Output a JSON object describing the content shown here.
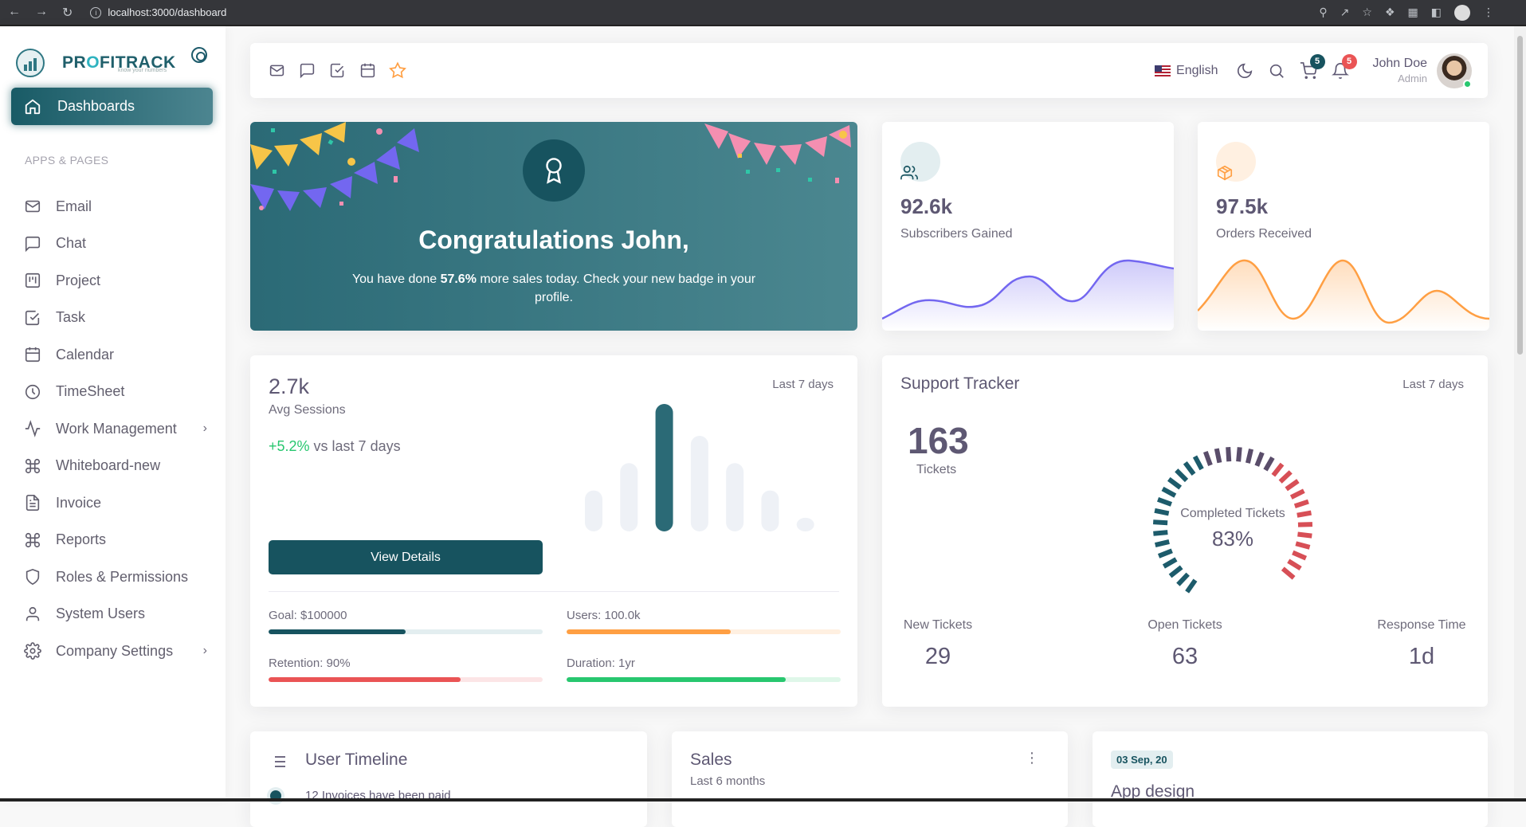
{
  "browser": {
    "url": "localhost:3000/dashboard"
  },
  "brand": {
    "name_prefix": "PR",
    "name_o": "O",
    "name_suffix": "FITRACK",
    "tagline": "know your numbers"
  },
  "sidebar": {
    "active": "Dashboards",
    "section": "APPS & PAGES",
    "items": [
      {
        "label": "Email",
        "icon": "mail-icon"
      },
      {
        "label": "Chat",
        "icon": "chat-icon"
      },
      {
        "label": "Project",
        "icon": "kanban-icon"
      },
      {
        "label": "Task",
        "icon": "check-square-icon"
      },
      {
        "label": "Calendar",
        "icon": "calendar-icon"
      },
      {
        "label": "TimeSheet",
        "icon": "clock-icon"
      },
      {
        "label": "Work Management",
        "icon": "activity-icon",
        "chevron": true
      },
      {
        "label": "Whiteboard-new",
        "icon": "command-icon"
      },
      {
        "label": "Invoice",
        "icon": "file-text-icon"
      },
      {
        "label": "Reports",
        "icon": "command-icon"
      },
      {
        "label": "Roles & Permissions",
        "icon": "shield-icon"
      },
      {
        "label": "System Users",
        "icon": "user-icon"
      },
      {
        "label": "Company Settings",
        "icon": "settings-icon",
        "chevron": true
      }
    ]
  },
  "topnav": {
    "language": "English",
    "cart_badge": "5",
    "notif_badge": "5",
    "user_name": "John Doe",
    "user_role": "Admin"
  },
  "congrats": {
    "title": "Congratulations John,",
    "msg_pre": "You have done ",
    "msg_bold": "57.6%",
    "msg_post": " more sales today. Check your new badge in your profile."
  },
  "subscribers": {
    "value": "92.6k",
    "label": "Subscribers Gained",
    "color": "#7367f0"
  },
  "orders": {
    "value": "97.5k",
    "label": "Orders Received",
    "color": "#ff9f43"
  },
  "sessions": {
    "value": "2.7k",
    "label": "Avg Sessions",
    "change": "+5.2%",
    "change_suffix": " vs last 7 days",
    "range": "Last 7 days",
    "button": "View Details",
    "chart_data": {
      "type": "bar",
      "values": [
        45,
        75,
        140,
        105,
        75,
        45,
        15
      ],
      "highlight_index": 2
    },
    "progress": [
      {
        "label": "Goal: $100000",
        "pct": 50,
        "color": "#17535f",
        "track": "#e3eef0"
      },
      {
        "label": "Users: 100.0k",
        "pct": 60,
        "color": "#ff9f43",
        "track": "#fff0e1"
      },
      {
        "label": "Retention: 90%",
        "pct": 70,
        "color": "#ea5455",
        "track": "#fce5e6"
      },
      {
        "label": "Duration: 1yr",
        "pct": 80,
        "color": "#28c76f",
        "track": "#dff7e9"
      }
    ]
  },
  "support": {
    "title": "Support Tracker",
    "range": "Last 7 days",
    "tickets": "163",
    "tickets_label": "Tickets",
    "gauge_label": "Completed Tickets",
    "gauge_value": "83%",
    "gauge_pct": 83,
    "new_label": "New Tickets",
    "new_value": "29",
    "open_label": "Open Tickets",
    "open_value": "63",
    "resp_label": "Response Time",
    "resp_value": "1d"
  },
  "timeline": {
    "title": "User Timeline",
    "item": "12 Invoices have been paid"
  },
  "sales": {
    "title": "Sales",
    "subtitle": "Last 6 months"
  },
  "app": {
    "date": "03 Sep, 20",
    "title": "App design"
  }
}
